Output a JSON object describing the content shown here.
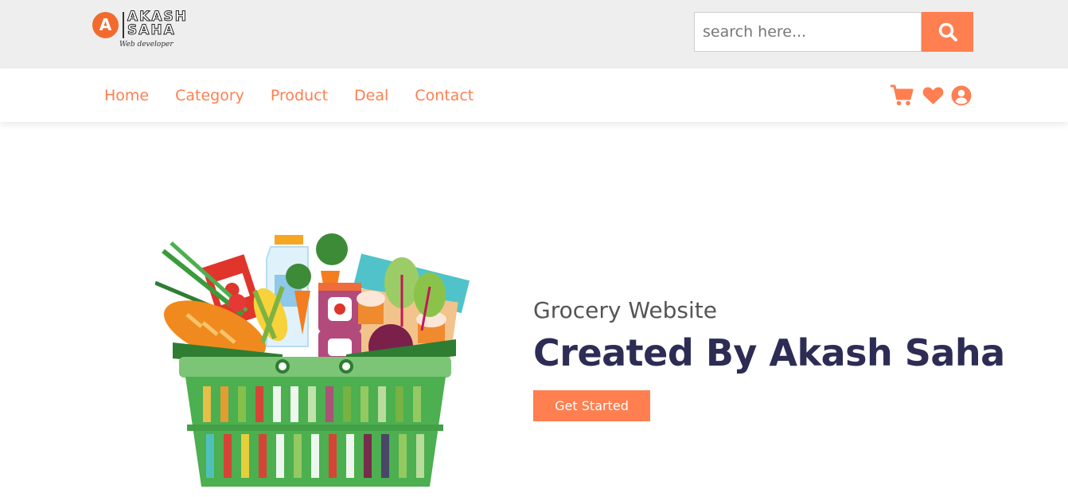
{
  "brand": {
    "logo_letter": "A",
    "name_line1": "AKASH",
    "name_line2": "SAHA",
    "tagline": "Web developer"
  },
  "search": {
    "placeholder": "search here...",
    "icon": "search-icon"
  },
  "nav": {
    "links": [
      {
        "label": "Home"
      },
      {
        "label": "Category"
      },
      {
        "label": "Product"
      },
      {
        "label": "Deal"
      },
      {
        "label": "Contact"
      }
    ],
    "icons": [
      "shopping-cart-icon",
      "heart-icon",
      "user-circle-icon"
    ]
  },
  "hero": {
    "subtitle": "Grocery Website",
    "title": "Created By Akash Saha",
    "cta_label": "Get Started"
  },
  "colors": {
    "accent": "#ff7f50",
    "heading": "#2c2c54",
    "topbar_bg": "#eeeeee"
  }
}
